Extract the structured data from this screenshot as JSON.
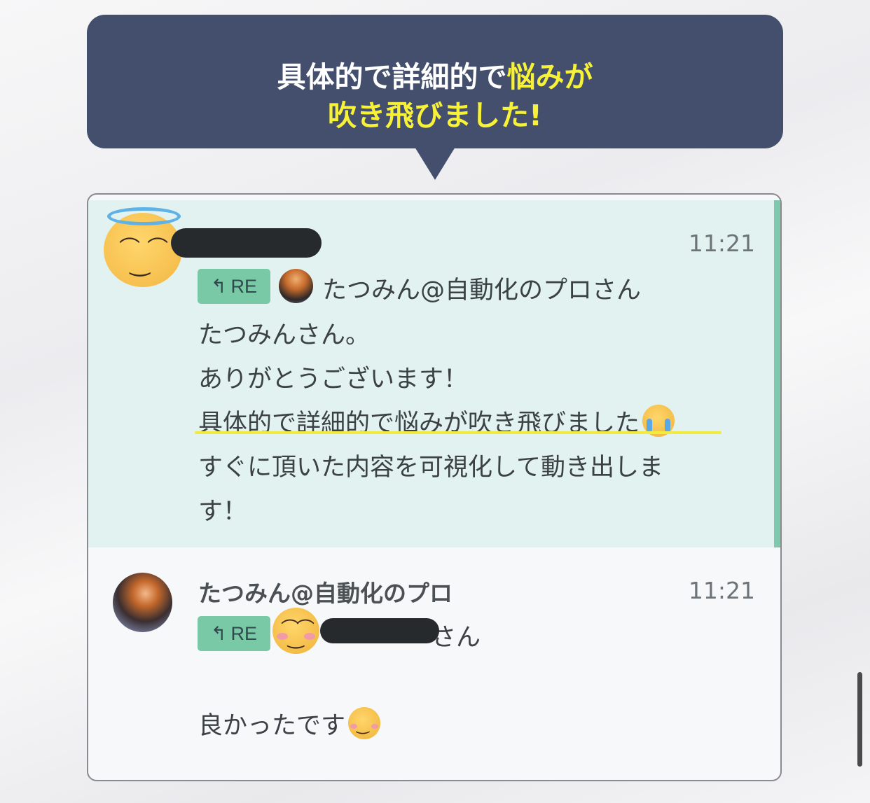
{
  "banner": {
    "line1_plain": "具体的で詳細的で",
    "line1_highlight": "悩みが",
    "line2_highlight": "吹き飛びました!"
  },
  "colors": {
    "banner_bg": "#434f6c",
    "banner_highlight": "#f7f238",
    "message_bg": "#e2f2f1",
    "accent": "#7ec9ae",
    "re_button": "#79c8a6",
    "underline": "#f2ea3c"
  },
  "message1": {
    "time": "11:21",
    "re_label": "RE",
    "reply_to": "たつみん@自動化のプロさん",
    "lines": [
      "たつみんさん。",
      "ありがとうございます！",
      "具体的で詳細的で悩みが吹き飛びました",
      "すぐに頂いた内容を可視化して動き出しま",
      "す！"
    ],
    "avatar_icon": "halo-smile-emoji-icon",
    "inline_emoji": "crying-face-emoji-icon"
  },
  "message2": {
    "sender": "たつみん@自動化のプロ",
    "time": "11:21",
    "re_label": "RE",
    "reply_to_suffix": "さん",
    "reply_icon": "blush-smile-emoji-icon",
    "body": "良かったです",
    "inline_emoji": "smiling-face-emoji-icon"
  }
}
